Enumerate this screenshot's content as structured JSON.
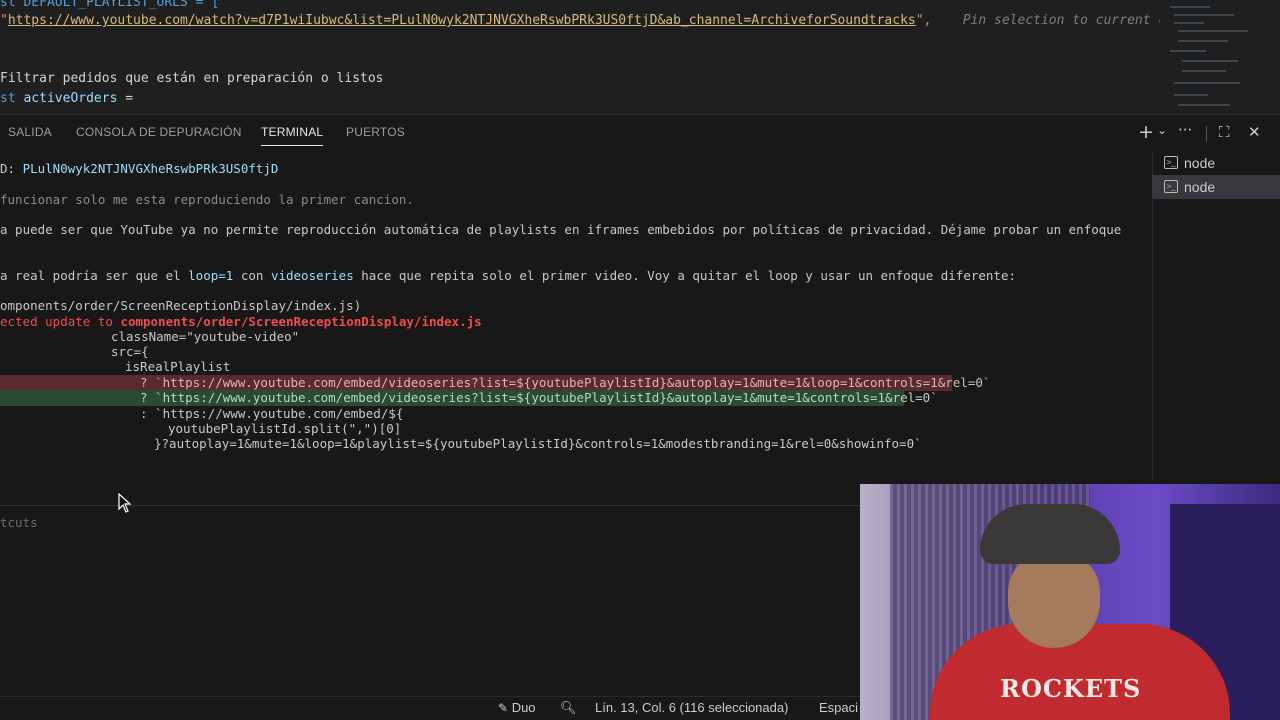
{
  "editor": {
    "line1": "st DEFAULT_PLAYLIST_URLS = [",
    "line2_url": "https://www.youtube.com/watch?v=d7P1wiIubwc&list=PLulN0wyk2NTJNVGXheRswbPRk3US0ftjD&ab_channel=ArchiveforSoundtracks",
    "line2_tail": "\",",
    "line2_hint": "Pin selection to current c",
    "line3": "Filtrar pedidos que están en preparación o listos",
    "line4_kw": "st",
    "line4_var": "activeOrders",
    "line4_op": "="
  },
  "panel": {
    "tabs": [
      "SALIDA",
      "CONSOLA DE DEPURACIÓN",
      "TERMINAL",
      "PUERTOS"
    ],
    "active_tab": "TERMINAL",
    "tools": {
      "add": "+",
      "dropdown": "⌄",
      "more": "···",
      "maximize": "⛶",
      "close": "✕"
    },
    "terminal_list": [
      "node",
      "node"
    ]
  },
  "terminal": {
    "l1_prefix": "D: ",
    "l1_value": "PLulN0wyk2NTJNVGXheRswbPRk3US0ftjD",
    "l2": "funcionar solo me esta reproduciendo la primer cancion.",
    "l3": "a puede ser que YouTube ya no permite reproducción automática de playlists en iframes embebidos por políticas de privacidad. Déjame probar un enfoque",
    "l4_a": "a real podría ser que el ",
    "l4_b": "loop=1",
    "l4_c": " con ",
    "l4_d": "videoseries",
    "l4_e": " hace que repita solo el primer video. Voy a quitar el loop y usar un enfoque diferente:",
    "l5": "omponents/order/ScreenReceptionDisplay/index.js)",
    "l6_a": "ected update to ",
    "l6_b": "components/order/ScreenReceptionDisplay/index.js",
    "l7": "className=\"youtube-video\"",
    "l8": "src={",
    "l9": "isRealPlaylist",
    "l10": "? `https://www.youtube.com/embed/videoseries?list=${youtubePlaylistId}&autoplay=1&mute=1&loop=1&controls=1&rel=0`",
    "l11": "? `https://www.youtube.com/embed/videoseries?list=${youtubePlaylistId}&autoplay=1&mute=1&controls=1&rel=0`",
    "l12": ": `https://www.youtube.com/embed/${",
    "l13": "youtubePlaylistId.split(\",\")[0]",
    "l14": "}?autoplay=1&mute=1&loop=1&playlist=${youtubePlaylistId}&controls=1&modestbranding=1&rel=0&showinfo=0`",
    "lower": "tcuts"
  },
  "status": {
    "duo": "Duo",
    "position": "Lín. 13, Col. 6 (116 seleccionada)",
    "spaces": "Espaci"
  },
  "webcam": {
    "shirt_text": "ROCKETS"
  }
}
